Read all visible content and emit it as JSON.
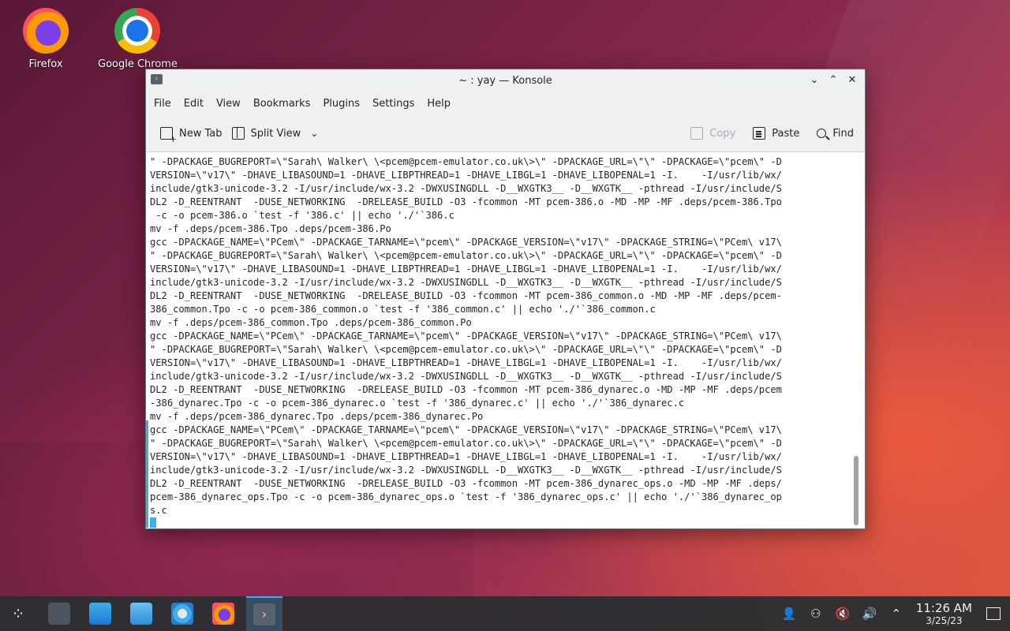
{
  "desktop": {
    "icons": [
      {
        "label": "Firefox",
        "icon": "firefox-icon"
      },
      {
        "label": "Google Chrome",
        "icon": "chrome-icon"
      }
    ]
  },
  "window": {
    "title": "~ : yay — Konsole",
    "app_icon": "terminal-prompt-icon",
    "buttons": {
      "minimize": "⌄",
      "maximize": "⌃",
      "close": "✕"
    }
  },
  "menubar": {
    "items": [
      "File",
      "Edit",
      "View",
      "Bookmarks",
      "Plugins",
      "Settings",
      "Help"
    ]
  },
  "toolbar": {
    "new_tab": "New Tab",
    "split_view": "Split View",
    "split_view_arrow": "⌄",
    "copy": "Copy",
    "paste": "Paste",
    "find": "Find"
  },
  "terminal": {
    "lines": [
      "\" -DPACKAGE_BUGREPORT=\\\"Sarah\\ Walker\\ \\<pcem@pcem-emulator.co.uk\\>\\\" -DPACKAGE_URL=\\\"\\\" -DPACKAGE=\\\"pcem\\\" -D",
      "VERSION=\\\"v17\\\" -DHAVE_LIBASOUND=1 -DHAVE_LIBPTHREAD=1 -DHAVE_LIBGL=1 -DHAVE_LIBOPENAL=1 -I.    -I/usr/lib/wx/",
      "include/gtk3-unicode-3.2 -I/usr/include/wx-3.2 -DWXUSINGDLL -D__WXGTK3__ -D__WXGTK__ -pthread -I/usr/include/S",
      "DL2 -D_REENTRANT  -DUSE_NETWORKING  -DRELEASE_BUILD -O3 -fcommon -MT pcem-386.o -MD -MP -MF .deps/pcem-386.Tpo",
      " -c -o pcem-386.o `test -f '386.c' || echo './'`386.c",
      "mv -f .deps/pcem-386.Tpo .deps/pcem-386.Po",
      "gcc -DPACKAGE_NAME=\\\"PCem\\\" -DPACKAGE_TARNAME=\\\"pcem\\\" -DPACKAGE_VERSION=\\\"v17\\\" -DPACKAGE_STRING=\\\"PCem\\ v17\\",
      "\" -DPACKAGE_BUGREPORT=\\\"Sarah\\ Walker\\ \\<pcem@pcem-emulator.co.uk\\>\\\" -DPACKAGE_URL=\\\"\\\" -DPACKAGE=\\\"pcem\\\" -D",
      "VERSION=\\\"v17\\\" -DHAVE_LIBASOUND=1 -DHAVE_LIBPTHREAD=1 -DHAVE_LIBGL=1 -DHAVE_LIBOPENAL=1 -I.    -I/usr/lib/wx/",
      "include/gtk3-unicode-3.2 -I/usr/include/wx-3.2 -DWXUSINGDLL -D__WXGTK3__ -D__WXGTK__ -pthread -I/usr/include/S",
      "DL2 -D_REENTRANT  -DUSE_NETWORKING  -DRELEASE_BUILD -O3 -fcommon -MT pcem-386_common.o -MD -MP -MF .deps/pcem-",
      "386_common.Tpo -c -o pcem-386_common.o `test -f '386_common.c' || echo './'`386_common.c",
      "mv -f .deps/pcem-386_common.Tpo .deps/pcem-386_common.Po",
      "gcc -DPACKAGE_NAME=\\\"PCem\\\" -DPACKAGE_TARNAME=\\\"pcem\\\" -DPACKAGE_VERSION=\\\"v17\\\" -DPACKAGE_STRING=\\\"PCem\\ v17\\",
      "\" -DPACKAGE_BUGREPORT=\\\"Sarah\\ Walker\\ \\<pcem@pcem-emulator.co.uk\\>\\\" -DPACKAGE_URL=\\\"\\\" -DPACKAGE=\\\"pcem\\\" -D",
      "VERSION=\\\"v17\\\" -DHAVE_LIBASOUND=1 -DHAVE_LIBPTHREAD=1 -DHAVE_LIBGL=1 -DHAVE_LIBOPENAL=1 -I.    -I/usr/lib/wx/",
      "include/gtk3-unicode-3.2 -I/usr/include/wx-3.2 -DWXUSINGDLL -D__WXGTK3__ -D__WXGTK__ -pthread -I/usr/include/S",
      "DL2 -D_REENTRANT  -DUSE_NETWORKING  -DRELEASE_BUILD -O3 -fcommon -MT pcem-386_dynarec.o -MD -MP -MF .deps/pcem",
      "-386_dynarec.Tpo -c -o pcem-386_dynarec.o `test -f '386_dynarec.c' || echo './'`386_dynarec.c",
      "mv -f .deps/pcem-386_dynarec.Tpo .deps/pcem-386_dynarec.Po",
      "gcc -DPACKAGE_NAME=\\\"PCem\\\" -DPACKAGE_TARNAME=\\\"pcem\\\" -DPACKAGE_VERSION=\\\"v17\\\" -DPACKAGE_STRING=\\\"PCem\\ v17\\",
      "\" -DPACKAGE_BUGREPORT=\\\"Sarah\\ Walker\\ \\<pcem@pcem-emulator.co.uk\\>\\\" -DPACKAGE_URL=\\\"\\\" -DPACKAGE=\\\"pcem\\\" -D",
      "VERSION=\\\"v17\\\" -DHAVE_LIBASOUND=1 -DHAVE_LIBPTHREAD=1 -DHAVE_LIBGL=1 -DHAVE_LIBOPENAL=1 -I.    -I/usr/lib/wx/",
      "include/gtk3-unicode-3.2 -I/usr/include/wx-3.2 -DWXUSINGDLL -D__WXGTK3__ -D__WXGTK__ -pthread -I/usr/include/S",
      "DL2 -D_REENTRANT  -DUSE_NETWORKING  -DRELEASE_BUILD -O3 -fcommon -MT pcem-386_dynarec_ops.o -MD -MP -MF .deps/",
      "pcem-386_dynarec_ops.Tpo -c -o pcem-386_dynarec_ops.o `test -f '386_dynarec_ops.c' || echo './'`386_dynarec_op",
      "s.c"
    ]
  },
  "taskbar": {
    "items": [
      {
        "name": "application-launcher",
        "icon": "launcher-icon",
        "glyph": "⁘"
      },
      {
        "name": "overview",
        "icon": "overview-icon",
        "glyph": ""
      },
      {
        "name": "discover",
        "icon": "discover-store-icon",
        "glyph": ""
      },
      {
        "name": "dolphin",
        "icon": "file-manager-icon",
        "glyph": ""
      },
      {
        "name": "system-settings",
        "icon": "settings-icon",
        "glyph": ""
      },
      {
        "name": "firefox",
        "icon": "firefox-icon",
        "glyph": ""
      },
      {
        "name": "konsole",
        "icon": "konsole-icon",
        "glyph": "›"
      }
    ],
    "tray": [
      {
        "name": "user",
        "glyph": "👤"
      },
      {
        "name": "accounts",
        "glyph": "⚇"
      },
      {
        "name": "mute",
        "glyph": "🔇"
      },
      {
        "name": "volume",
        "glyph": "🔊"
      },
      {
        "name": "expand",
        "glyph": "⌃"
      }
    ],
    "clock": {
      "time": "11:26 AM",
      "date": "3/25/23"
    }
  },
  "colors": {
    "accent": "#3daee9",
    "window_bg": "#eff0f1",
    "terminal_bg": "#ffffff",
    "terminal_fg": "#232629",
    "taskbar_bg": "#2a2e32"
  }
}
